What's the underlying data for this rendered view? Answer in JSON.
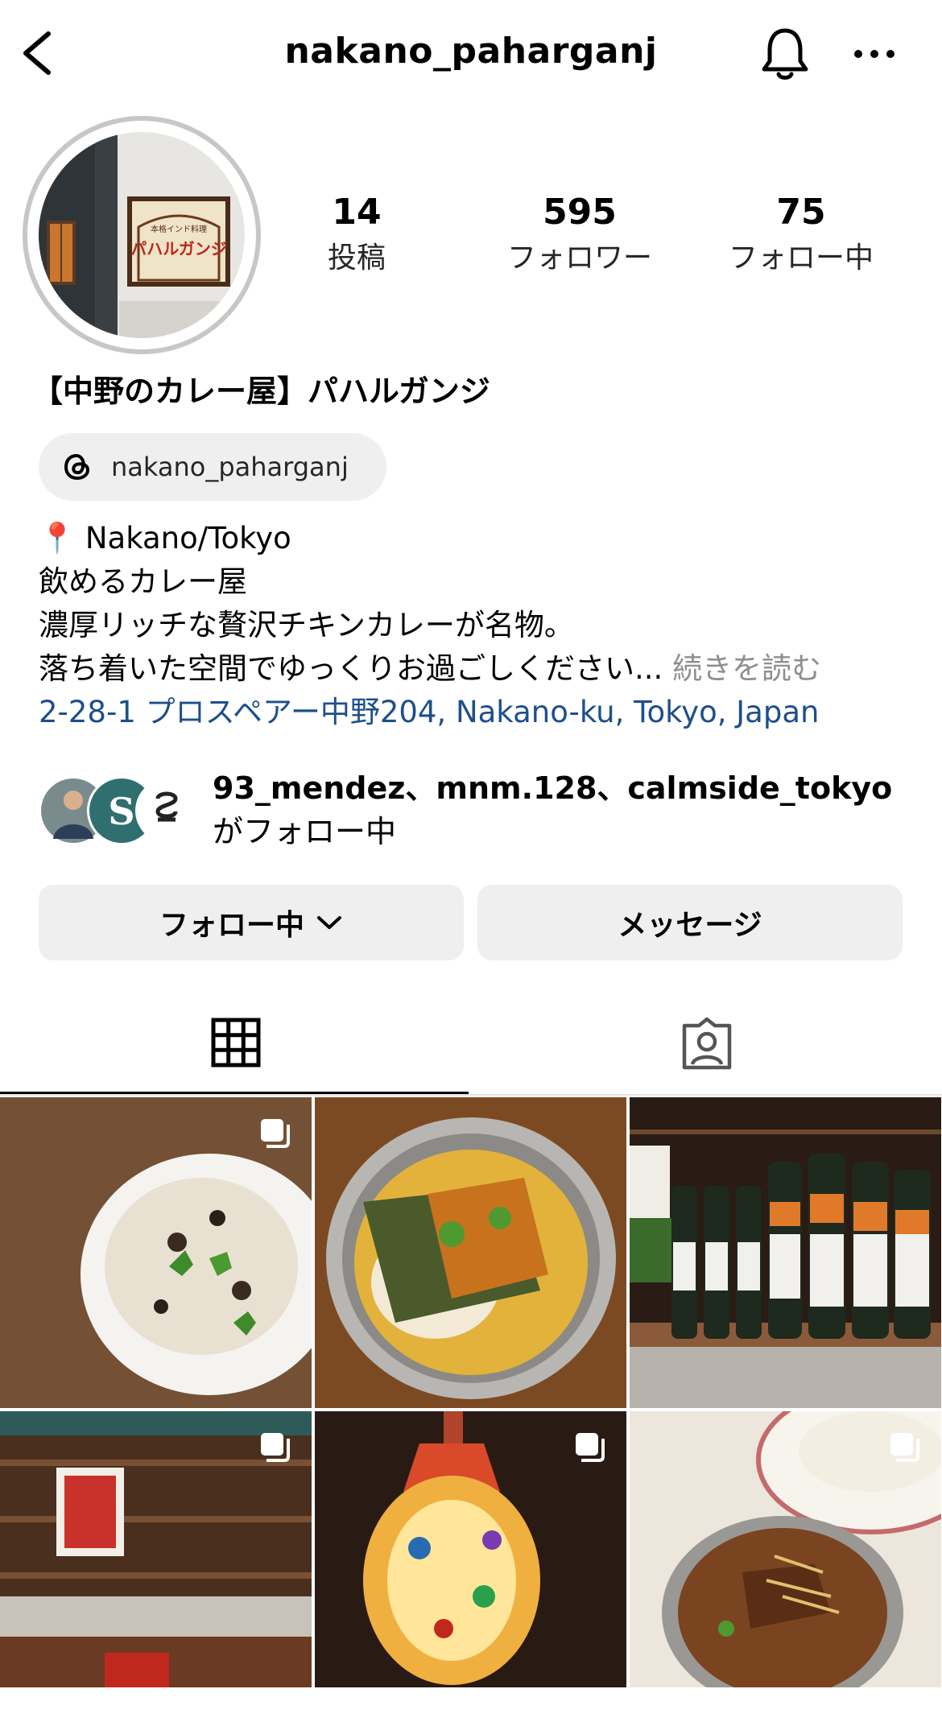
{
  "header": {
    "username": "nakano_paharganj"
  },
  "stats": [
    {
      "value": "14",
      "label": "投稿"
    },
    {
      "value": "595",
      "label": "フォロワー"
    },
    {
      "value": "75",
      "label": "フォロー中"
    }
  ],
  "profile": {
    "display_name": "【中野のカレー屋】パハルガンジ",
    "avatar_sign_text": "パハルガンジ",
    "threads_handle": "nakano_paharganj",
    "bio": {
      "line1_pin": "📍",
      "line1": "Nakano/Tokyo",
      "line2": "飲めるカレー屋",
      "line3": "濃厚リッチな贅沢チキンカレーが名物。",
      "line4": "落ち着いた空間でゆっくりお過ごしください...",
      "more": "続きを読む",
      "address": "2-28-1 プロスペアー中野204, Nakano-ku, Tokyo, Japan"
    }
  },
  "followed_by": {
    "names": "93_mendez、mnm.128、calmside_tokyo",
    "suffix": "がフォロー中"
  },
  "actions": {
    "follow_label": "フォロー中",
    "message_label": "メッセージ"
  },
  "tabs": {
    "active": "grid",
    "icons": [
      "grid-icon",
      "tagged-icon"
    ]
  },
  "posts": [
    {
      "subject": "cheese dish",
      "multi": true
    },
    {
      "subject": "curry bowl",
      "multi": false
    },
    {
      "subject": "beer bottles",
      "multi": false
    },
    {
      "subject": "bar shelves",
      "multi": true
    },
    {
      "subject": "mosaic lamp",
      "multi": true
    },
    {
      "subject": "curry pot",
      "multi": true
    }
  ]
}
